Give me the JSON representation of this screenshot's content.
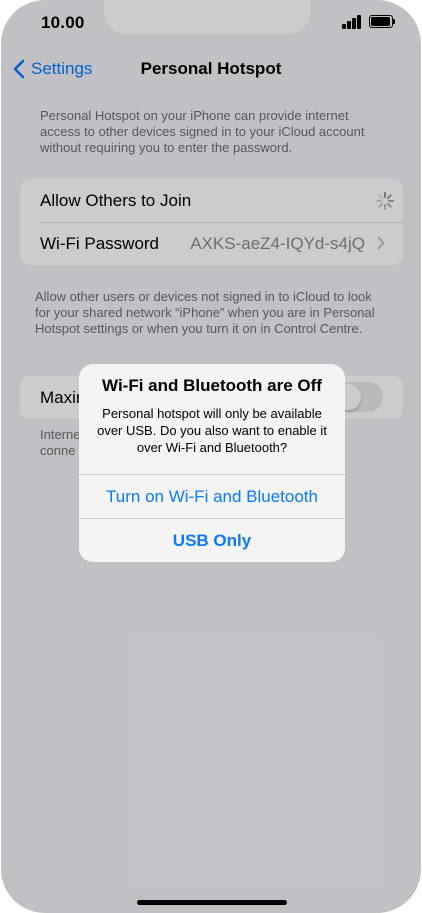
{
  "status_bar": {
    "time": "10.00"
  },
  "nav": {
    "back_label": "Settings",
    "title": "Personal Hotspot"
  },
  "intro_text": "Personal Hotspot on your iPhone can provide internet access to other devices signed in to your iCloud account without requiring you to enter the password.",
  "settings": {
    "allow_label": "Allow Others to Join",
    "wifi_password_label": "Wi-Fi Password",
    "wifi_password_value": "AXKS-aeZ4-IQYd-s4jQ"
  },
  "group_footer": "Allow other users or devices not signed in to iCloud to look for your shared network “iPhone” when you are in Personal Hotspot settings or when you turn it on in Control Centre.",
  "max_row": {
    "label": "Maxir"
  },
  "bottom_text": {
    "line1": "Interne",
    "line2": "conne"
  },
  "alert": {
    "title": "Wi-Fi and Bluetooth are Off",
    "message": "Personal hotspot will only be available over USB. Do you also want to enable it over Wi-Fi and Bluetooth?",
    "primary_button": "Turn on Wi-Fi and Bluetooth",
    "secondary_button": "USB Only"
  },
  "colors": {
    "accent": "#007aff",
    "background": "#f2f2f7",
    "secondary_text": "#6d6d72"
  }
}
